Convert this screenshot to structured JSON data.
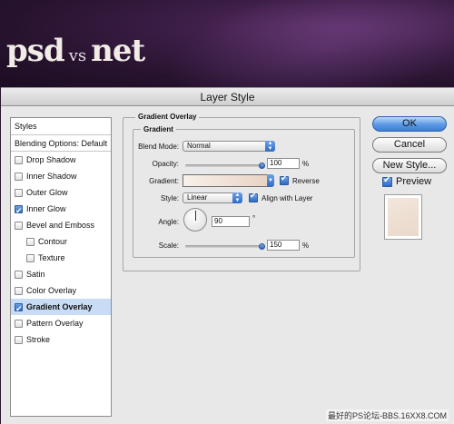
{
  "banner": {
    "logo_psd": "psd",
    "logo_vs": "vs",
    "logo_net": "net"
  },
  "dialog": {
    "title": "Layer Style"
  },
  "styles_list": {
    "header": "Styles",
    "blending": "Blending Options: Default",
    "items": [
      {
        "label": "Drop Shadow",
        "checked": false
      },
      {
        "label": "Inner Shadow",
        "checked": false
      },
      {
        "label": "Outer Glow",
        "checked": false
      },
      {
        "label": "Inner Glow",
        "checked": true
      },
      {
        "label": "Bevel and Emboss",
        "checked": false
      },
      {
        "label": "Contour",
        "checked": false
      },
      {
        "label": "Texture",
        "checked": false
      },
      {
        "label": "Satin",
        "checked": false
      },
      {
        "label": "Color Overlay",
        "checked": false
      },
      {
        "label": "Gradient Overlay",
        "checked": true,
        "selected": true
      },
      {
        "label": "Pattern Overlay",
        "checked": false
      },
      {
        "label": "Stroke",
        "checked": false
      }
    ]
  },
  "panel": {
    "title": "Gradient Overlay",
    "group": "Gradient",
    "blend_mode_label": "Blend Mode:",
    "blend_mode_value": "Normal",
    "opacity_label": "Opacity:",
    "opacity_value": "100",
    "opacity_unit": "%",
    "gradient_label": "Gradient:",
    "reverse_label": "Reverse",
    "reverse_checked": true,
    "style_label": "Style:",
    "style_value": "Linear",
    "align_label": "Align with Layer",
    "align_checked": true,
    "angle_label": "Angle:",
    "angle_value": "90",
    "angle_unit": "°",
    "scale_label": "Scale:",
    "scale_value": "150",
    "scale_unit": "%"
  },
  "buttons": {
    "ok": "OK",
    "cancel": "Cancel",
    "new_style": "New Style...",
    "preview": "Preview"
  },
  "preview_checked": true,
  "watermark": "最好的PS论坛-BBS.16XX8.COM",
  "colors": {
    "accent": "#3b7fd6",
    "selection": "#c8dcf5",
    "gradient_start": "#f7f1ec",
    "gradient_end": "#e9d3c4"
  }
}
